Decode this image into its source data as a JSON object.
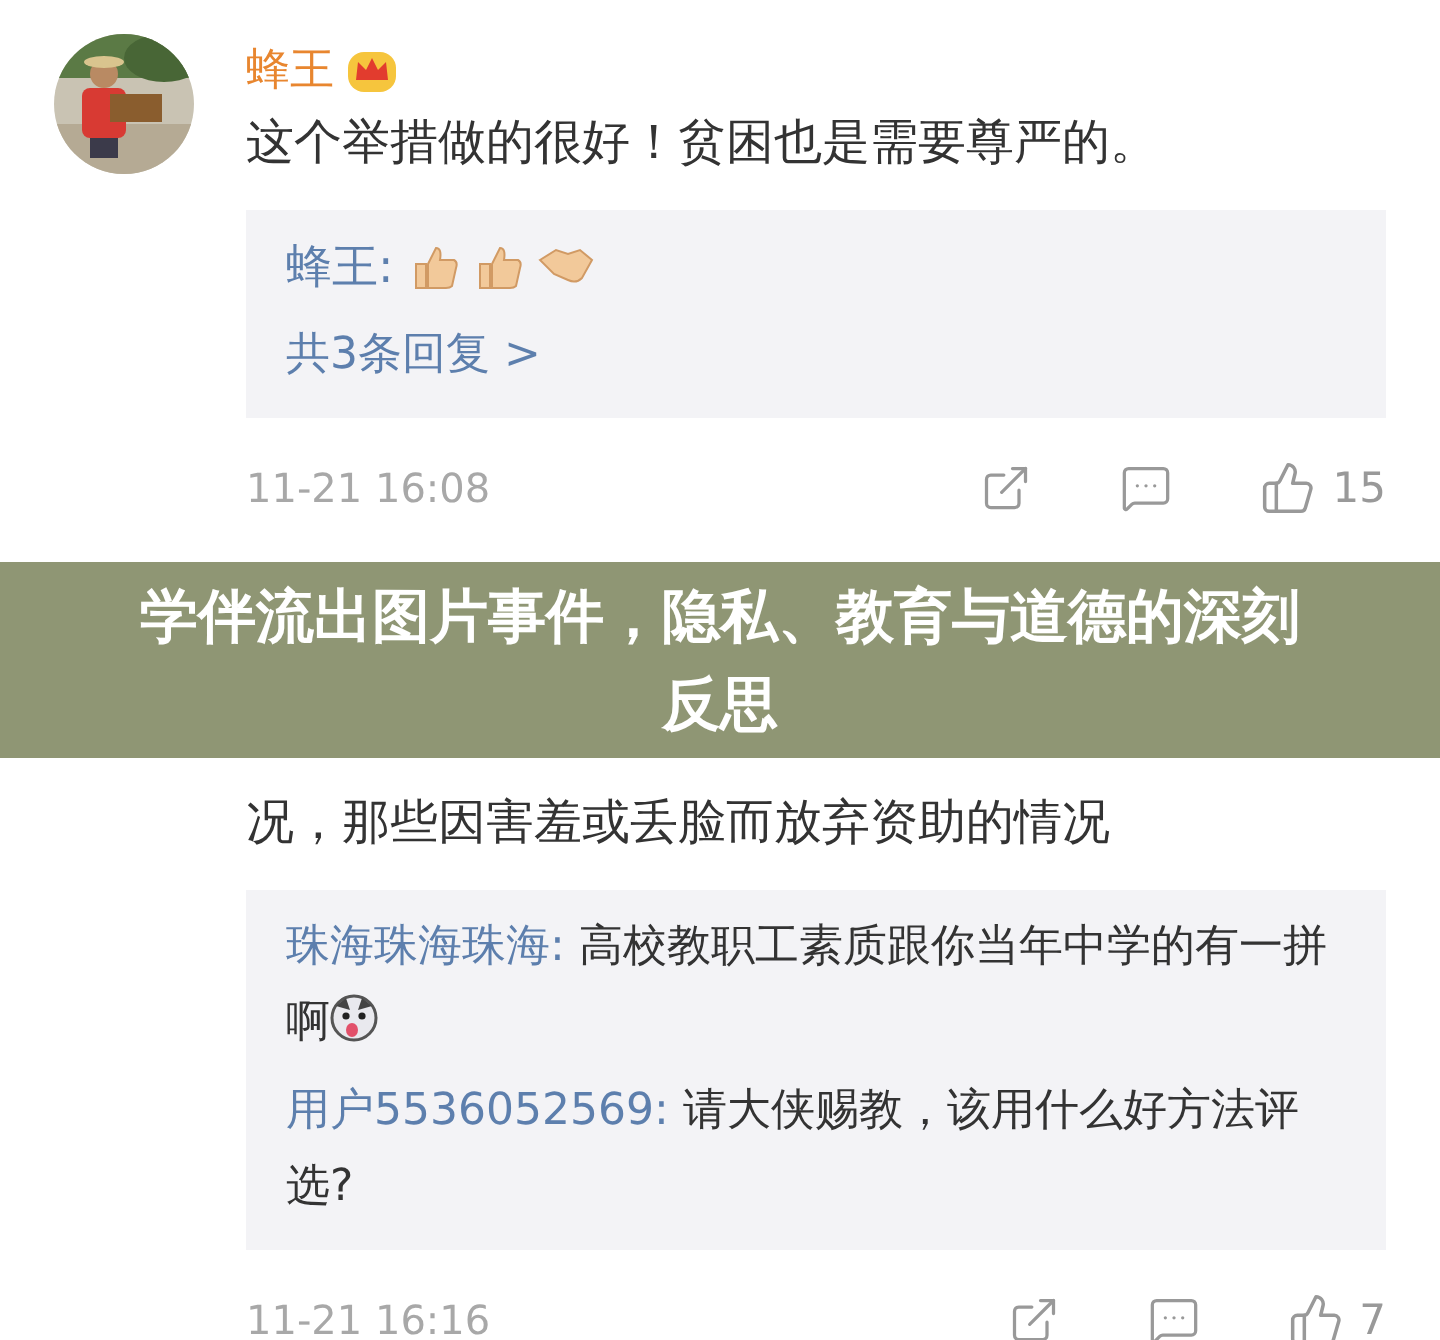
{
  "comments": [
    {
      "author": "蜂王",
      "badge": true,
      "lines": [
        "这个举措做的很好！贫困也是需要尊严的。"
      ],
      "replies": [
        {
          "kind": "emoji",
          "user": "蜂王:"
        },
        {
          "kind": "more",
          "text": "共3条回复 >"
        }
      ],
      "time": "11-21 16:08",
      "likes": "15"
    },
    {
      "lines": [
        "况，那些因害羞或丢脸而放弃资助的情况"
      ],
      "replies": [
        {
          "kind": "text",
          "user": "珠海珠海珠海:",
          "text": "高校教职工素质跟你当年中学的有一拼啊",
          "trailing_emoji": true
        },
        {
          "kind": "text",
          "user": "用户5536052569:",
          "text": "请大侠赐教，该用什么好方法评选?",
          "trailing_emoji": false
        }
      ],
      "time": "11-21 16:16",
      "likes": "7"
    }
  ],
  "banner": {
    "title": "学伴流出图片事件，隐私、教育与道德的深刻反思"
  }
}
